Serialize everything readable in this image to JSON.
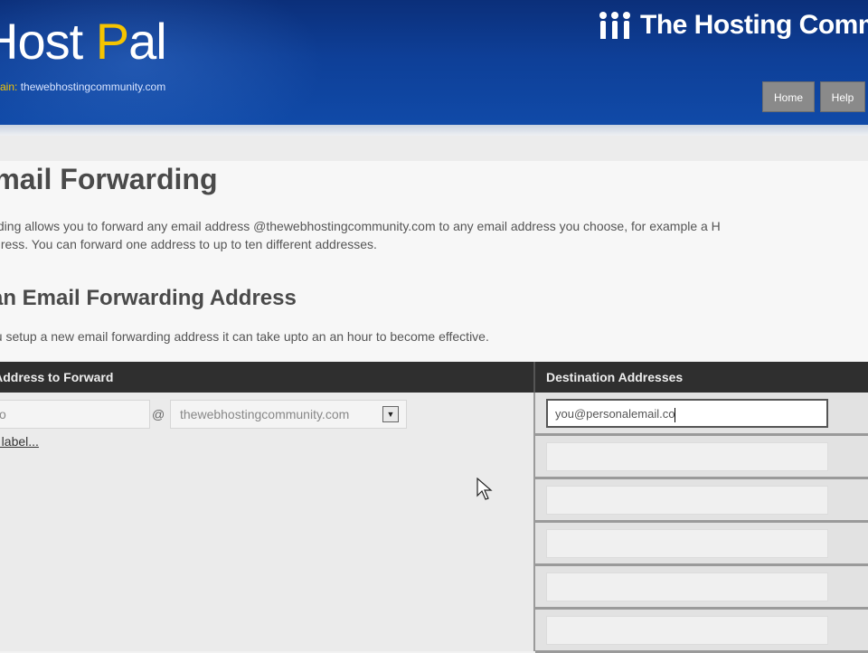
{
  "header": {
    "brand_prefix": "H",
    "brand_mid": "ost ",
    "brand_highlight": "P",
    "brand_suffix": "al",
    "domain_label": "ain:",
    "domain_value": "thewebhostingcommunity.com",
    "community_title": "The Hosting Comm",
    "nav": {
      "home": "Home",
      "help": "Help"
    },
    "colors": {
      "bar": "#0e3f97",
      "accent": "#f5c400"
    }
  },
  "page": {
    "title": "mail Forwarding",
    "intro_line1": "forwarding allows you to forward any email address @thewebhostingcommunity.com to any email address you choose, for example a H",
    "intro_line2": "oo address. You can forward one address to up to ten different addresses.",
    "section_title": " an Email Forwarding Address",
    "note": "you setup a new email forwarding address it can take upto an an hour to become effective."
  },
  "form": {
    "col_source": "il Address to Forward",
    "col_destination": "Destination Addresses",
    "local_part_value": "o",
    "at_sign": "@",
    "domain_selected": "thewebhostingcommunity.com",
    "label_link": "a label...",
    "destinations": [
      {
        "value": "you@personalemail.co",
        "active": true
      },
      {
        "value": "",
        "active": false
      },
      {
        "value": "",
        "active": false
      },
      {
        "value": "",
        "active": false
      },
      {
        "value": "",
        "active": false
      },
      {
        "value": "",
        "active": false
      }
    ]
  }
}
